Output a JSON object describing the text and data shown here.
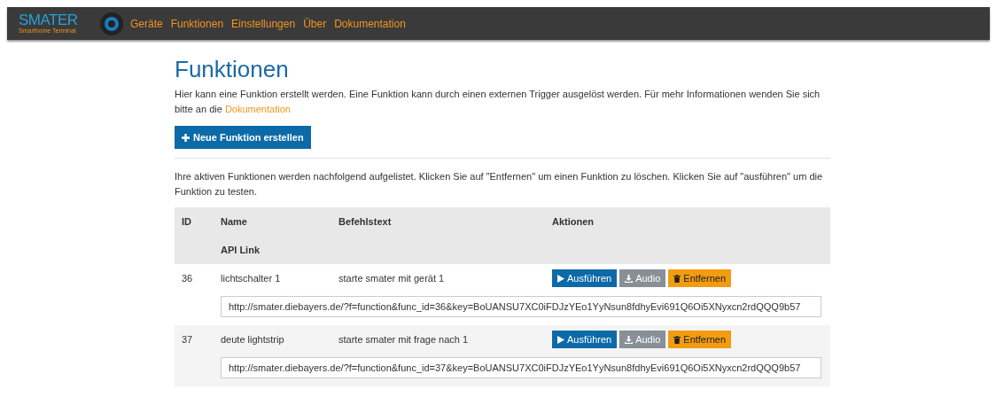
{
  "navbar": {
    "logo": "SMATER",
    "logo_subtitle": "Smarthome Terminal",
    "items": [
      {
        "label": "Geräte"
      },
      {
        "label": "Funktionen"
      },
      {
        "label": "Einstellungen"
      },
      {
        "label": "Über"
      },
      {
        "label": "Dokumentation"
      }
    ]
  },
  "page": {
    "title": "Funktionen",
    "intro": "Hier kann eine Funktion erstellt werden. Eine Funktion kann durch einen externen Trigger ausgelöst werden. Für mehr Informationen wenden Sie sich bitte an die",
    "intro_link": "Dokumentation",
    "create_button": "Neue Funktion erstellen",
    "list_intro": "Ihre aktiven Funktionen werden nachfolgend aufgelistet. Klicken Sie auf \"Entfernen\" um einen Funktion zu löschen. Klicken Sie auf \"ausführen\" um die Funktion zu testen."
  },
  "table": {
    "columns": [
      "ID",
      "Name",
      "Befehlstext",
      "Aktionen"
    ],
    "second_header": "API Link",
    "rows": [
      {
        "id": "36",
        "name": "lichtschalter 1",
        "command": "starte smater mit gerät 1",
        "buttons": [
          {
            "kind": "run",
            "label": "Ausführen"
          },
          {
            "kind": "audio",
            "label": "Audio"
          },
          {
            "kind": "remove",
            "label": "Entfernen"
          }
        ],
        "api_link": "http://smater.diebayers.de/?f=function&func_id=36&key=BoUANSU7XC0iFDJzYEo1YyNsun8fdhyEvi691Q6Oi5XNyxcn2rdQQQ9b57"
      },
      {
        "id": "37",
        "name": "deute lightstrip",
        "command": "starte smater mit frage nach 1",
        "buttons": [
          {
            "kind": "run",
            "label": "Ausführen"
          },
          {
            "kind": "audio",
            "label": "Audio"
          },
          {
            "kind": "remove",
            "label": "Entfernen"
          }
        ],
        "api_link": "http://smater.diebayers.de/?f=function&func_id=37&key=BoUANSU7XC0iFDJzYEo1YyNsun8fdhyEvi691Q6Oi5XNyxcn2rdQQQ9b57"
      }
    ]
  }
}
